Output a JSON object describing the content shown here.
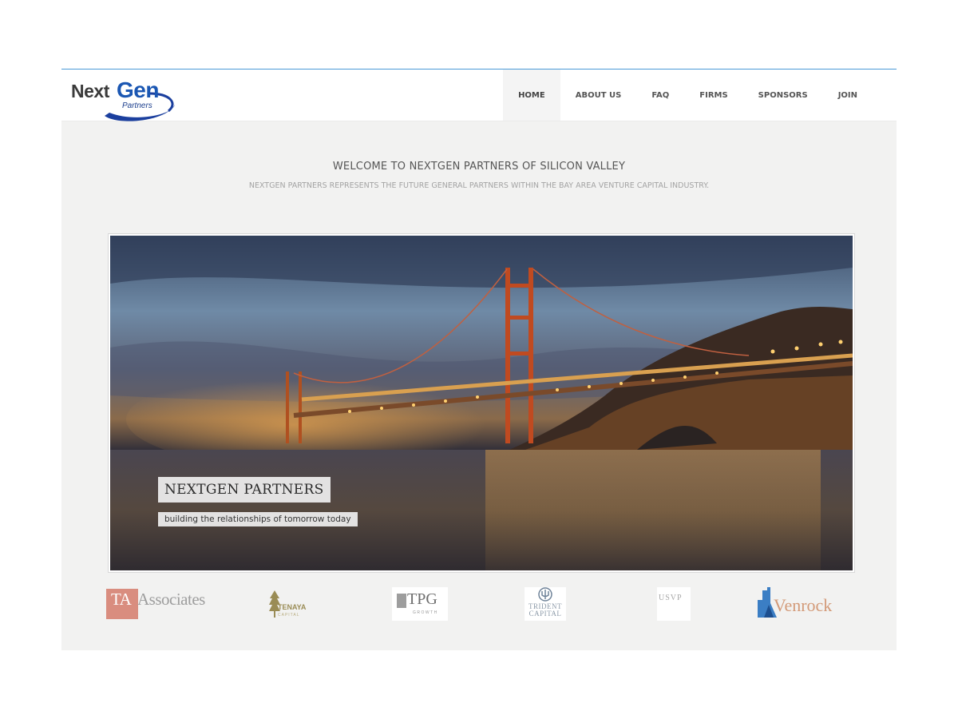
{
  "logo": {
    "word_next": "Next",
    "word_gen": "Gen",
    "word_partners": "Partners"
  },
  "nav": {
    "items": [
      {
        "label": "HOME",
        "active": true
      },
      {
        "label": "ABOUT US",
        "active": false
      },
      {
        "label": "FAQ",
        "active": false
      },
      {
        "label": "FIRMS",
        "active": false
      },
      {
        "label": "SPONSORS",
        "active": false
      },
      {
        "label": "JOIN",
        "active": false
      }
    ]
  },
  "intro": {
    "heading": "WELCOME TO NEXTGEN PARTNERS OF SILICON VALLEY",
    "tagline": "NEXTGEN PARTNERS REPRESENTS THE FUTURE GENERAL PARTNERS WITHIN THE BAY AREA VENTURE CAPITAL INDUSTRY."
  },
  "hero": {
    "caption_title": "NEXTGEN PARTNERS",
    "caption_subtitle": "building the relationships of tomorrow today"
  },
  "sponsors": {
    "ta": {
      "part1": "TA",
      "part2": "Associates"
    },
    "tenaya": {
      "name": "TENAYA",
      "sub": "CAPITAL"
    },
    "tpg": {
      "name": "TPG",
      "sub": "GROWTH"
    },
    "trident": {
      "line1": "TRIDENT",
      "line2": "CAPITAL"
    },
    "usvp": {
      "name": "USVP"
    },
    "venrock": {
      "name": "Venrock"
    }
  },
  "colors": {
    "accent_line": "#4a9ad8",
    "logo_blue": "#1b57b3",
    "page_bg": "#f2f2f1"
  }
}
